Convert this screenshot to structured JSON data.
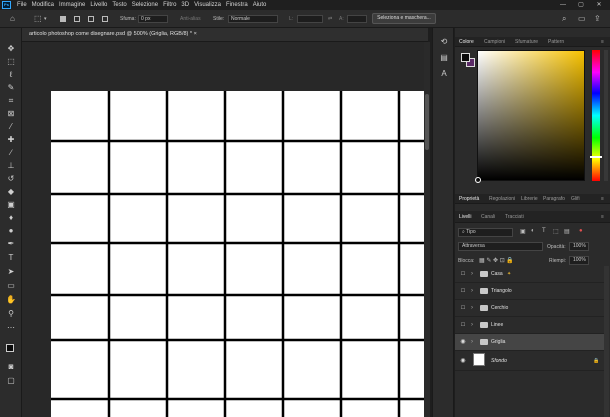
{
  "app": {
    "logo": "Ps",
    "menu": [
      "File",
      "Modifica",
      "Immagine",
      "Livello",
      "Testo",
      "Selezione",
      "Filtro",
      "3D",
      "Visualizza",
      "Finestra",
      "Aiuto"
    ],
    "window_controls": [
      "—",
      "▢",
      "✕"
    ]
  },
  "options_bar": {
    "sfuma_label": "Sfuma:",
    "sfuma_value": "0 px",
    "antialias_label": "Anti-alias",
    "stile_label": "Stile:",
    "stile_value": "Normale",
    "l_label": "L:",
    "a_label": "A:",
    "select_mask_button": "Seleziona e maschera..."
  },
  "document": {
    "tab_title": "articolo photoshop come disegnare.psd @ 500% (Griglia, RGB/8) *",
    "close_icon": "×"
  },
  "canvas": {
    "page_color": "#ffffff",
    "line_color": "#000000",
    "background": "#282828",
    "grid_columns": 7,
    "grid_rows": 6
  },
  "color_panel": {
    "tabs": [
      "Colore",
      "Campioni",
      "Sfumature",
      "Pattern"
    ],
    "foreground": "#0b0b0b",
    "background": "#5b2b67",
    "hue_color": "#f6c100"
  },
  "properties_tabs": [
    "Proprietà",
    "Regolazioni",
    "Librerie",
    "Paragrafo",
    "Glifi"
  ],
  "layers_panel": {
    "tabs": [
      "Livelli",
      "Canali",
      "Tracciati"
    ],
    "search_placeholder": "Tipo",
    "blend_mode": "Attraversa",
    "opacity_label": "Opacità:",
    "opacity_value": "100%",
    "lock_label": "Blocca:",
    "fill_label": "Riempi:",
    "fill_value": "100%",
    "layers": [
      {
        "name": "Casa",
        "visible": false,
        "type": "group",
        "selected": false
      },
      {
        "name": "Triangolo",
        "visible": false,
        "type": "group",
        "selected": false
      },
      {
        "name": "Cerchio",
        "visible": false,
        "type": "group",
        "selected": false
      },
      {
        "name": "Linee",
        "visible": false,
        "type": "group",
        "selected": false
      },
      {
        "name": "Griglia",
        "visible": true,
        "type": "group",
        "selected": true
      },
      {
        "name": "Sfondo",
        "visible": true,
        "type": "background",
        "selected": false
      }
    ]
  }
}
